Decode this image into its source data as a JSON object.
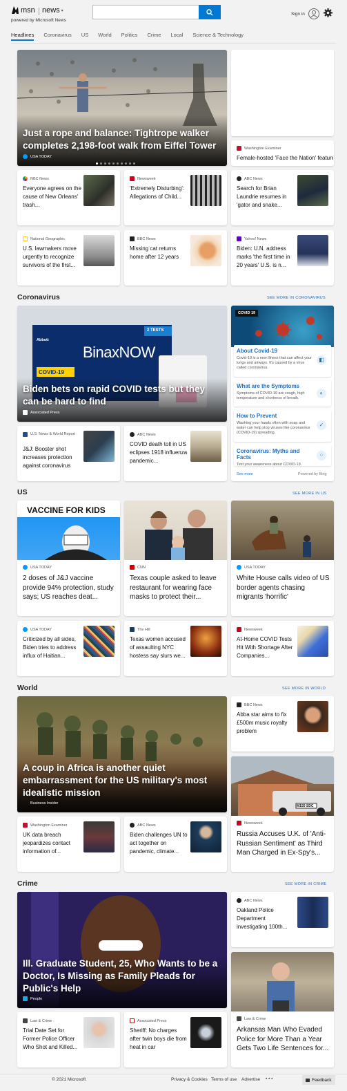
{
  "header": {
    "brand": "msn",
    "section": "news",
    "powered": "powered by Microsoft News",
    "search_placeholder": "",
    "signin": "Sign in"
  },
  "nav": [
    "Headlines",
    "Coronavirus",
    "US",
    "World",
    "Politics",
    "Crime",
    "Local",
    "Science & Technology"
  ],
  "top": {
    "hero_title": "Just a rope and balance: Tightrope walker completes 2,198-foot walk from Eiffel Tower",
    "hero_source": "USA TODAY",
    "side_source": "Washington Examiner",
    "side_title": "Female-hosted 'Face the Nation' feature...",
    "cards": [
      {
        "source": "NBC News",
        "title": "Everyone agrees on the cause of New Orleans' trash...",
        "logo": "#6b2d8f"
      },
      {
        "source": "Newsweek",
        "title": "'Extremely Disturbing': Allegations of Child...",
        "logo": "#d0021b"
      },
      {
        "source": "ABC News",
        "title": "Search for Brian Laundrie resumes in 'gator and snake...",
        "logo": "#222222"
      },
      {
        "source": "National Geographic",
        "title": "U.S. lawmakers move urgently to recognize survivors of the first...",
        "logo": "#ffcc00"
      },
      {
        "source": "BBC News",
        "title": "Missing cat returns home after 12 years",
        "logo": "#222222"
      },
      {
        "source": "Yahoo! News",
        "title": "Biden: U.N. address marks 'the first time in 20 years' U.S. is n...",
        "logo": "#5f01d1"
      }
    ]
  },
  "coronavirus": {
    "heading": "Coronavirus",
    "see_more": "SEE MORE IN CORONAVIRUS",
    "hero_title": "Biden bets on rapid COVID tests but they can be hard to find",
    "hero_source": "Associated Press",
    "hero_image_text": {
      "binax": "BinaxNOW",
      "tests": "2 TESTS",
      "covid": "COVID-19",
      "brand": "Abbott"
    },
    "cards": [
      {
        "source": "U.S. News & World Report",
        "title": "J&J: Booster shot increases protection against coronavirus",
        "logo": "#1b4f9c"
      },
      {
        "source": "ABC News",
        "title": "COVID death toll in US eclipses 1918 influenza pandemic...",
        "logo": "#222222"
      }
    ],
    "panel": {
      "badge": "COVID 19",
      "items": [
        {
          "title": "About Covid-19",
          "body": "Covid-19 is a new illness that can affect your lungs and airways. It's caused by a virus called coronavirus."
        },
        {
          "title": "What are the Symptoms",
          "body": "Symptoms of COVID-19 are cough, high temperature and shortness of breath."
        },
        {
          "title": "How to Prevent",
          "body": "Washing your hands often with soap and water can help stop viruses like coronavirus (COVID-19) spreading."
        },
        {
          "title": "Coronavirus: Myths and Facts",
          "body": "Test your awareness about COVID-19."
        }
      ],
      "see_more": "See more",
      "powered": "Powered by Bing"
    }
  },
  "us": {
    "heading": "US",
    "see_more": "SEE MORE IN US",
    "image_caption": "VACCINE FOR KIDS",
    "big": [
      {
        "source": "USA TODAY",
        "title": "2 doses of J&J vaccine provide 94% protection, study says; US reaches deat...",
        "logo": "#009bff"
      },
      {
        "source": "CNN",
        "title": "Texas couple asked to leave restaurant for wearing face masks to protect their...",
        "logo": "#cc0000"
      },
      {
        "source": "USA TODAY",
        "title": "White House calls video of US border agents chasing migrants 'horrific'",
        "logo": "#009bff"
      }
    ],
    "cards": [
      {
        "source": "USA TODAY",
        "title": "Criticized by all sides, Biden tries to address influx of Haitian...",
        "logo": "#009bff"
      },
      {
        "source": "The Hill",
        "title": "Texas women accused of assaulting NYC hostess say slurs we...",
        "logo": "#1b3a6b"
      },
      {
        "source": "Newsweek",
        "title": "At-Home COVID Tests Hit With Shortage After Companies...",
        "logo": "#d0021b"
      }
    ]
  },
  "world": {
    "heading": "World",
    "see_more": "SEE MORE IN WORLD",
    "hero_title": "A coup in Africa is another quiet embarrassment for the US military's most idealistic mission",
    "hero_source": "Business Insider",
    "side_card": {
      "source": "BBC News",
      "title": "Abba star aims to fix £500m music royalty problem",
      "logo": "#222222"
    },
    "plate": "M155 SDC",
    "side_big": {
      "source": "Newsweek",
      "title": "Russia Accuses U.K. of 'Anti-Russian Sentiment' as Third Man Charged in Ex-Spy's...",
      "logo": "#d0021b"
    },
    "cards": [
      {
        "source": "Washington Examiner",
        "title": "UK data breach jeopardizes contact information of...",
        "logo": "#c8102e"
      },
      {
        "source": "ABC News",
        "title": "Biden challenges UN to act together on pandemic, climate...",
        "logo": "#222222"
      }
    ]
  },
  "crime": {
    "heading": "Crime",
    "see_more": "SEE MORE IN CRIME",
    "hero_title": "Ill. Graduate Student, 25, Who Wants to be a Doctor, Is Missing as Family Pleads for Public's Help",
    "hero_source": "People",
    "side_card": {
      "source": "ABC News",
      "title": "Oakland Police Department investigating 100th...",
      "logo": "#222222"
    },
    "side_big": {
      "source": "Law & Crime",
      "title": "Arkansas Man Who Evaded Police for More Than a Year Gets Two Life Sentences for...",
      "logo": "#444444"
    },
    "cards": [
      {
        "source": "Law & Crime",
        "title": "Trial Date Set for Former Police Officer Who Shot and Killed...",
        "logo": "#444444"
      },
      {
        "source": "Associated Press",
        "title": "Sheriff: No charges after twin boys die from heat in car",
        "logo": "#ffffff"
      }
    ]
  },
  "footer": {
    "copyright": "© 2021 Microsoft",
    "links": [
      "Privacy & Cookies",
      "Terms of use",
      "Advertise"
    ],
    "more": "• • •",
    "feedback": "Feedback"
  },
  "colors": {
    "accent": "#0078d4",
    "link": "#2a6db5",
    "background": "#f2f2f2"
  }
}
